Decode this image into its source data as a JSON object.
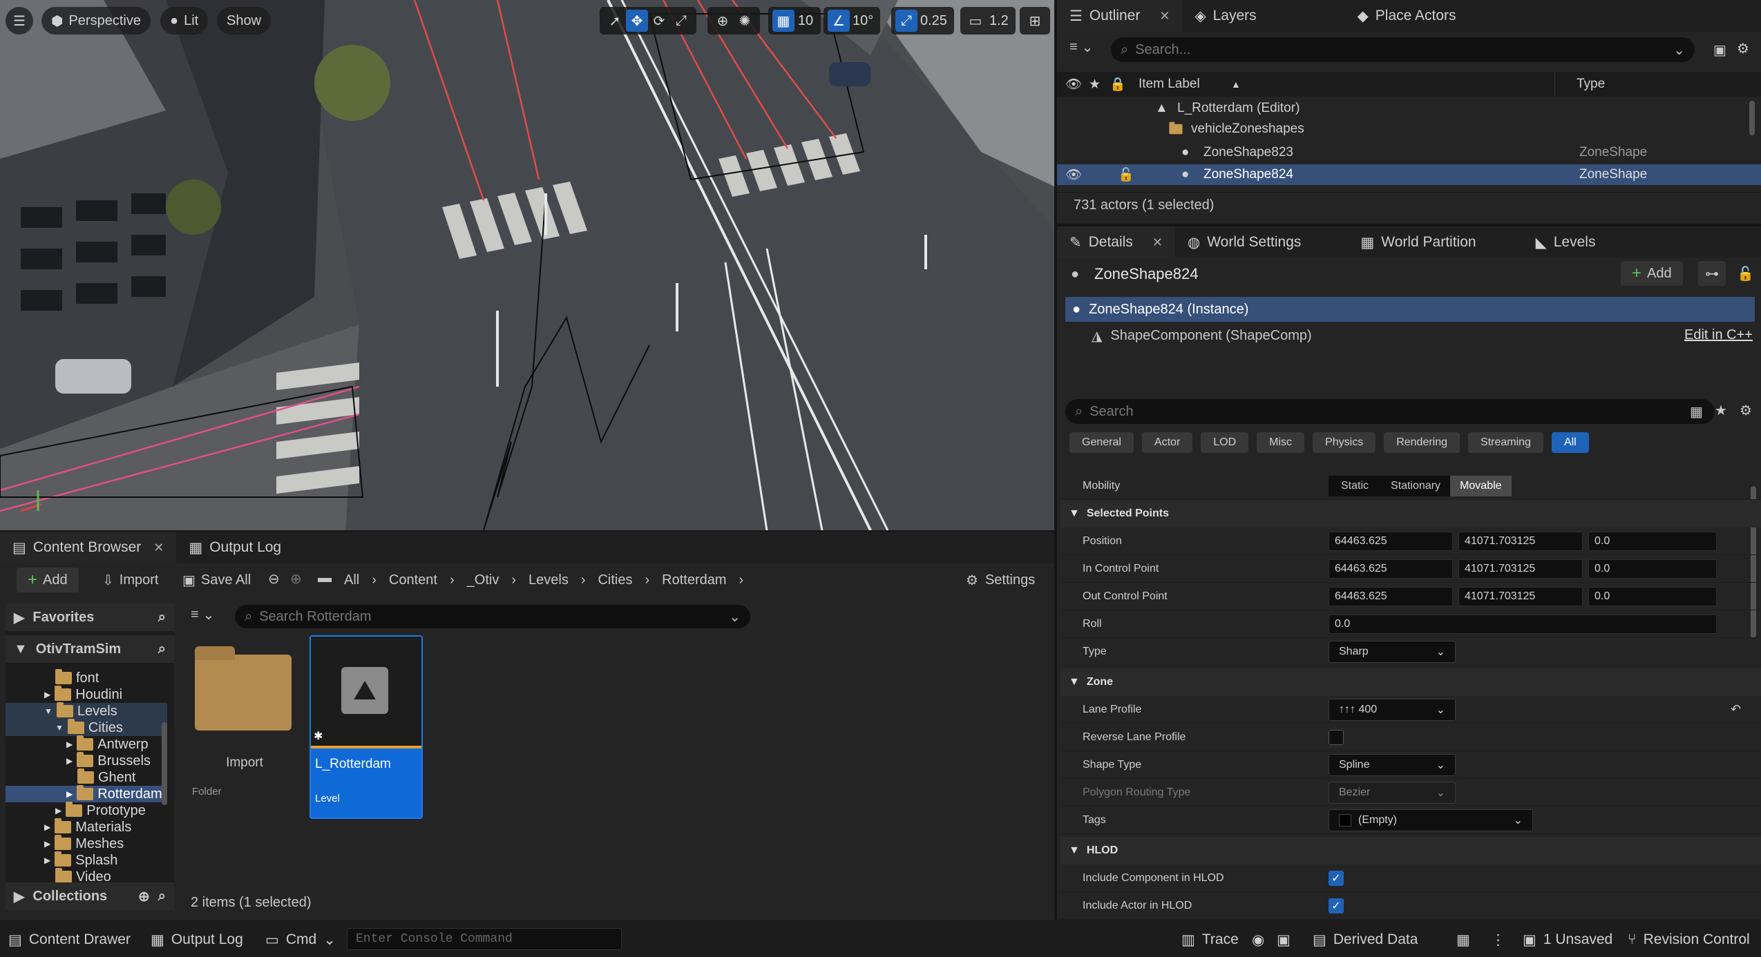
{
  "viewport": {
    "perspective": "Perspective",
    "lit": "Lit",
    "show": "Show",
    "grid_snap": "10",
    "rot_snap": "10°",
    "scale_snap": "0.25",
    "cam_speed": "1.2"
  },
  "outliner": {
    "tabs": [
      "Outliner",
      "Layers",
      "Place Actors"
    ],
    "search_placeholder": "Search...",
    "col_label": "Item Label",
    "col_type": "Type",
    "rows": [
      {
        "label": "L_Rotterdam (Editor)",
        "type": ""
      },
      {
        "label": "vehicleZoneshapes",
        "type": ""
      },
      {
        "label": "ZoneShape823",
        "type": "ZoneShape"
      },
      {
        "label": "ZoneShape824",
        "type": "ZoneShape"
      }
    ],
    "status": "731 actors (1 selected)"
  },
  "details": {
    "tabs": [
      "Details",
      "World Settings",
      "World Partition",
      "Levels"
    ],
    "actor": "ZoneShape824",
    "add": "Add",
    "instance": "ZoneShape824 (Instance)",
    "component": "ShapeComponent (ShapeComp)",
    "edit_cpp": "Edit in C++",
    "search_placeholder": "Search",
    "categories": [
      "General",
      "Actor",
      "LOD",
      "Misc",
      "Physics",
      "Rendering",
      "Streaming",
      "All"
    ],
    "mobility_label": "Mobility",
    "mobility": [
      "Static",
      "Stationary",
      "Movable"
    ],
    "sec_points": "Selected Points",
    "position": {
      "label": "Position",
      "x": "64463.625",
      "y": "41071.703125",
      "z": "0.0"
    },
    "in_cp": {
      "label": "In Control Point",
      "x": "64463.625",
      "y": "41071.703125",
      "z": "0.0"
    },
    "out_cp": {
      "label": "Out Control Point",
      "x": "64463.625",
      "y": "41071.703125",
      "z": "0.0"
    },
    "roll": {
      "label": "Roll",
      "v": "0.0"
    },
    "type": {
      "label": "Type",
      "v": "Sharp"
    },
    "sec_zone": "Zone",
    "lane_profile": {
      "label": "Lane Profile",
      "v": "400"
    },
    "reverse": {
      "label": "Reverse Lane Profile"
    },
    "shape_type": {
      "label": "Shape Type",
      "v": "Spline"
    },
    "polygon": {
      "label": "Polygon Routing Type",
      "v": "Bezier"
    },
    "tags": {
      "label": "Tags",
      "v": "(Empty)"
    },
    "sec_hlod": "HLOD",
    "inc_comp": {
      "label": "Include Component in HLOD"
    },
    "inc_actor": {
      "label": "Include Actor in HLOD"
    }
  },
  "content": {
    "tabs": [
      "Content Browser",
      "Output Log"
    ],
    "add": "Add",
    "import": "Import",
    "save_all": "Save All",
    "crumbs": [
      "All",
      "Content",
      "_Otiv",
      "Levels",
      "Cities",
      "Rotterdam"
    ],
    "settings": "Settings",
    "favorites": "Favorites",
    "project": "OtivTramSim",
    "collections": "Collections",
    "search_placeholder": "Search Rotterdam",
    "tree": [
      "font",
      "Houdini",
      "Levels",
      "Cities",
      "Antwerp",
      "Brussels",
      "Ghent",
      "Rotterdam",
      "Prototype",
      "Materials",
      "Meshes",
      "Splash",
      "Video"
    ],
    "asset1": {
      "name": "Import",
      "type": "Folder"
    },
    "asset2": {
      "name": "L_Rotterdam",
      "type": "Level"
    },
    "count": "2 items (1 selected)"
  },
  "statusbar": {
    "drawer": "Content Drawer",
    "output": "Output Log",
    "cmd": "Cmd",
    "console_placeholder": "Enter Console Command",
    "trace": "Trace",
    "derived": "Derived Data",
    "unsaved": "1 Unsaved",
    "revision": "Revision Control"
  }
}
